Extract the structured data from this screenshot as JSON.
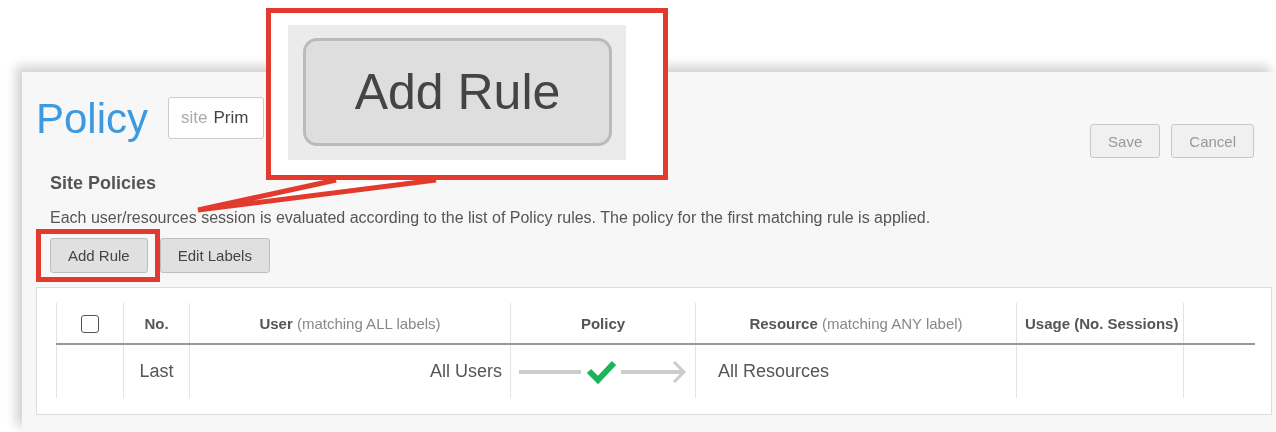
{
  "header": {
    "title": "Policy",
    "site_field": {
      "label": "site",
      "value": "Prim"
    },
    "buttons": [
      {
        "label": "Save",
        "disabled": true
      },
      {
        "label": "Cancel",
        "disabled": true
      }
    ]
  },
  "section": {
    "title": "Site Policies",
    "description": "Each user/resources session is evaluated according to the list of Policy rules. The policy for the first matching rule is applied.",
    "buttons": [
      {
        "label": "Add Rule",
        "highlighted": true
      },
      {
        "label": "Edit Labels",
        "highlighted": false
      }
    ]
  },
  "table": {
    "columns": [
      {
        "kind": "checkbox",
        "checked": false
      },
      {
        "kind": "text",
        "label": "No."
      },
      {
        "kind": "text",
        "label": "User",
        "note": "(matching ALL labels)"
      },
      {
        "kind": "text",
        "label": "Policy"
      },
      {
        "kind": "text",
        "label": "Resource",
        "note": "(matching ANY label)"
      },
      {
        "kind": "text",
        "label": "Usage (No. Sessions)"
      }
    ],
    "rows": [
      {
        "no": "Last",
        "user": "All Users",
        "kind": "allow",
        "resource": "All Resources"
      }
    ]
  },
  "callout": {
    "magnified_button": "Add Rule"
  }
}
